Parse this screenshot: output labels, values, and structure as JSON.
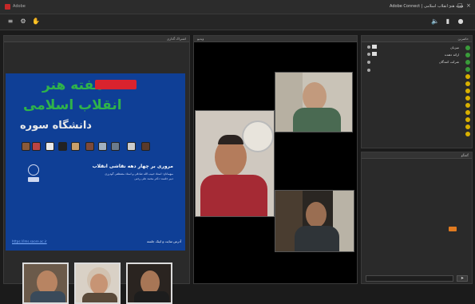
{
  "window": {
    "title_left": "Adobe",
    "title_right": "Adobe Connect | هفته هنر انقلاب اسلامی"
  },
  "share_pod": {
    "header": "اشتراک گذاری",
    "poster": {
      "title_line1": "هفته هنر",
      "title_line2": "انقلاب اسلامی",
      "title_line3": "دانشگاه سوره",
      "subtitle": "مروری بر چهار دهه نقاشی انقلاب",
      "body1": "میهمانان: استاد حبیب الله صادقی و استاد مصطفی گودرزی",
      "body2": "دبیر جلسه: دکتر محمد علی رجبی",
      "link": "https://lms.soore.ac.ir",
      "footer": "آدرس سایت و لینک جلسه"
    },
    "colors": {
      "poster_bg": "#0f3f96",
      "accent_green": "#2fb34a",
      "accent_red": "#d9232e",
      "title_white": "#e9e9e9"
    }
  },
  "video_pod": {
    "header": "ویدیو"
  },
  "attendees_pod": {
    "header": "حاضرین",
    "rows": [
      "میزبان",
      "ارائه دهنده",
      "شرکت کنندگان",
      "",
      "",
      "",
      "",
      "",
      "",
      "",
      "",
      "",
      ""
    ]
  },
  "chat_pod": {
    "header": "گفتگو",
    "messages": [
      "",
      "",
      "",
      "",
      "",
      "",
      "",
      ""
    ]
  },
  "icons": [
    "menu-icon",
    "settings-icon",
    "hand-icon",
    "mic-icon",
    "camera-icon",
    "speaker-icon"
  ]
}
